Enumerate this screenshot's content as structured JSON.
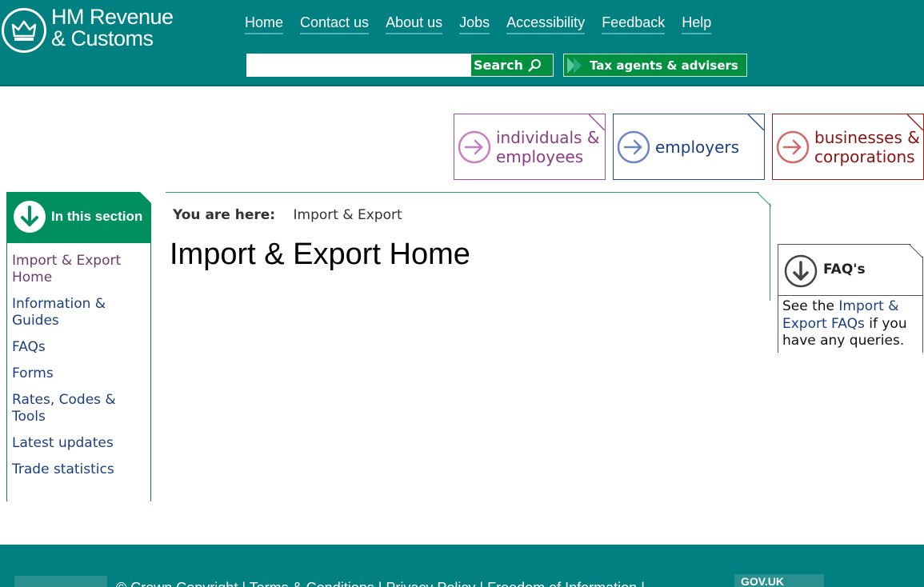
{
  "header": {
    "logo_line1": "HM Revenue",
    "logo_line2": "& Customs",
    "nav": [
      "Home",
      "Contact us",
      "About us",
      "Jobs",
      "Accessibility",
      "Feedback",
      "Help"
    ],
    "search_value": "",
    "search_label": "Search",
    "agents_label": "Tax agents & advisers"
  },
  "audiences": {
    "individuals_line1": "individuals &",
    "individuals_line2": "employees",
    "employers": "employers",
    "businesses_line1": "businesses &",
    "businesses_line2": "corporations"
  },
  "section": {
    "title": "In this section",
    "items": [
      {
        "label_1": "Import & Export",
        "label_2": "Home"
      },
      {
        "label_1": "Information &",
        "label_2": "Guides"
      },
      {
        "label_1": "FAQs"
      },
      {
        "label_1": "Forms"
      },
      {
        "label_1": "Rates, Codes &",
        "label_2": "Tools"
      },
      {
        "label_1": "Latest updates"
      },
      {
        "label_1": "Trade statistics"
      }
    ]
  },
  "main": {
    "breadcrumb_label": "You are here:",
    "breadcrumb_item": "Import & Export",
    "title": "Import & Export Home"
  },
  "faq": {
    "title": "FAQ's",
    "text_before": "See the ",
    "link_line1": "Import &",
    "link_line2": "Export FAQs",
    "text_after_1": " if you",
    "text_after_2": "have any queries."
  },
  "footer": {
    "links": "© Crown Copyright  |  Terms & Conditions  |  Privacy Policy  |  Freedom of Information  |",
    "gov": "GOV.UK"
  },
  "colors": {
    "brand_teal": "#008080",
    "section_green": "#009060",
    "individuals": "#a24d9e",
    "employers": "#2c4d8c",
    "businesses": "#9b1c1c",
    "link_blue": "#1a3f80"
  }
}
